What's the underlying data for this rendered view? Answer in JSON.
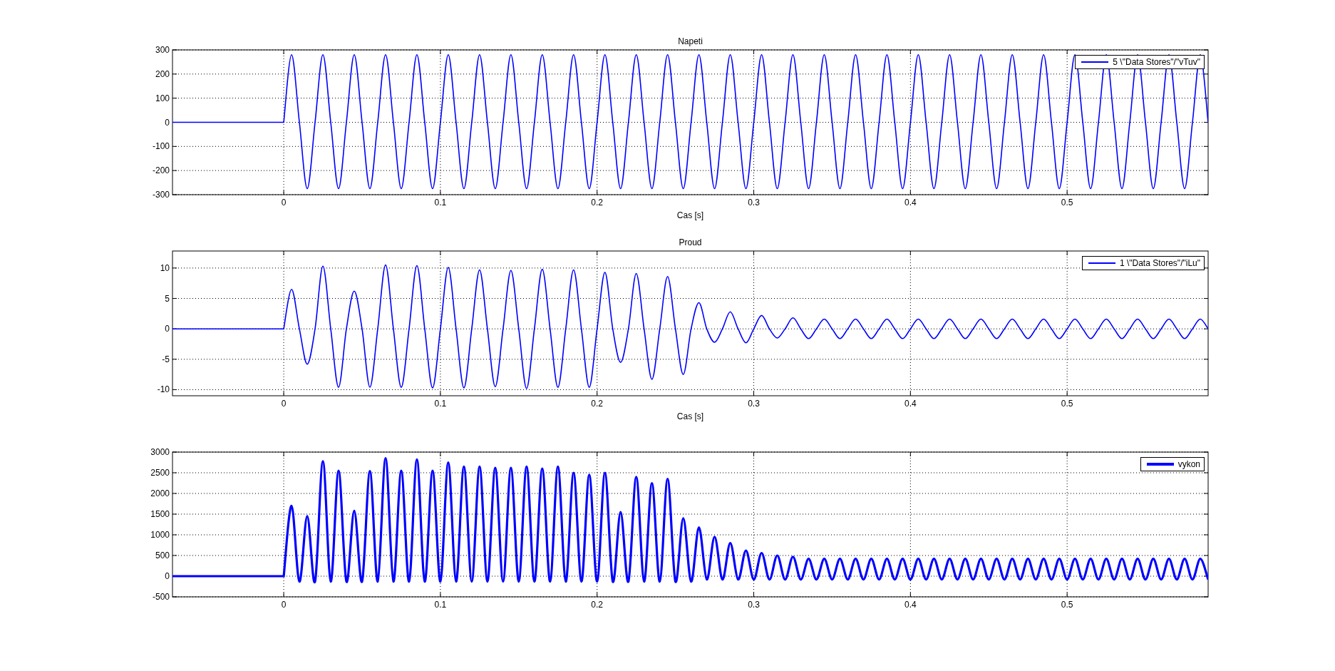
{
  "figure": {
    "axes": [
      {
        "kind": "thin",
        "chart_data": {
          "type": "line",
          "grid": true,
          "title": "Napeti",
          "xlabel": "Cas [s]",
          "xlim": [
            -0.071,
            0.59
          ],
          "ylim": [
            -300,
            300
          ],
          "xticks": [
            0,
            0.1,
            0.2,
            0.3,
            0.4,
            0.5
          ],
          "yticks": [
            -300,
            -200,
            -100,
            0,
            100,
            200,
            300
          ],
          "x": [
            -0.071,
            0,
            0.005,
            0.01,
            0.015,
            0.02,
            0.025,
            0.03,
            0.035,
            0.04,
            0.045,
            0.05,
            0.055,
            0.06,
            0.065,
            0.07,
            0.075,
            0.08,
            0.085,
            0.09,
            0.095,
            0.1,
            0.105,
            0.11,
            0.115,
            0.12,
            0.125,
            0.13,
            0.135,
            0.14,
            0.145,
            0.15,
            0.155,
            0.16,
            0.165,
            0.17,
            0.175,
            0.18,
            0.185,
            0.19,
            0.195,
            0.2,
            0.205,
            0.21,
            0.215,
            0.22,
            0.225,
            0.23,
            0.235,
            0.24,
            0.245,
            0.25,
            0.255,
            0.26,
            0.265,
            0.27,
            0.275,
            0.28,
            0.285,
            0.29,
            0.295,
            0.3,
            0.305,
            0.31,
            0.315,
            0.32,
            0.325,
            0.33,
            0.335,
            0.34,
            0.345,
            0.35,
            0.355,
            0.36,
            0.365,
            0.37,
            0.375,
            0.38,
            0.385,
            0.39,
            0.395,
            0.4,
            0.405,
            0.41,
            0.415,
            0.42,
            0.425,
            0.43,
            0.435,
            0.44,
            0.445,
            0.45,
            0.455,
            0.46,
            0.465,
            0.47,
            0.475,
            0.48,
            0.485,
            0.49,
            0.495,
            0.5,
            0.505,
            0.51,
            0.515,
            0.52,
            0.525,
            0.53,
            0.535,
            0.54,
            0.545,
            0.55,
            0.555,
            0.56,
            0.565,
            0.57,
            0.575,
            0.58,
            0.585,
            0.59
          ],
          "series": [
            {
              "name": "5 \\\"Data Stores\"/\"vTuv\"",
              "color": "#0000ff",
              "values": [
                0,
                0,
                280,
                0,
                -275,
                0,
                280,
                0,
                -275,
                0,
                280,
                0,
                -275,
                0,
                280,
                0,
                -275,
                0,
                280,
                0,
                -275,
                0,
                280,
                0,
                -275,
                0,
                280,
                0,
                -275,
                0,
                280,
                0,
                -275,
                0,
                280,
                0,
                -275,
                0,
                280,
                0,
                -275,
                0,
                280,
                0,
                -275,
                0,
                280,
                0,
                -275,
                0,
                280,
                0,
                -275,
                0,
                280,
                0,
                -275,
                0,
                280,
                0,
                -275,
                0,
                280,
                0,
                -275,
                0,
                280,
                0,
                -275,
                0,
                280,
                0,
                -275,
                0,
                280,
                0,
                -275,
                0,
                280,
                0,
                -275,
                0,
                280,
                0,
                -275,
                0,
                280,
                0,
                -275,
                0,
                280,
                0,
                -275,
                0,
                280,
                0,
                -275,
                0,
                280,
                0,
                -275,
                0,
                280,
                0,
                -275,
                0,
                280,
                0,
                -275,
                0,
                280,
                0,
                -275,
                0,
                280,
                0,
                -275,
                0,
                280,
                0
              ]
            }
          ]
        }
      },
      {
        "kind": "thin",
        "chart_data": {
          "type": "line",
          "grid": true,
          "title": "Proud",
          "xlabel": "Cas [s]",
          "xlim": [
            -0.071,
            0.59
          ],
          "ylim": [
            -11,
            12.8
          ],
          "xticks": [
            0,
            0.1,
            0.2,
            0.3,
            0.4,
            0.5
          ],
          "yticks": [
            -10,
            -5,
            0,
            5,
            10
          ],
          "x": [
            -0.071,
            0,
            0.005,
            0.01,
            0.015,
            0.02,
            0.025,
            0.03,
            0.035,
            0.04,
            0.045,
            0.05,
            0.055,
            0.06,
            0.065,
            0.07,
            0.075,
            0.08,
            0.085,
            0.09,
            0.095,
            0.1,
            0.105,
            0.11,
            0.115,
            0.12,
            0.125,
            0.13,
            0.135,
            0.14,
            0.145,
            0.15,
            0.155,
            0.16,
            0.165,
            0.17,
            0.175,
            0.18,
            0.185,
            0.19,
            0.195,
            0.2,
            0.205,
            0.21,
            0.215,
            0.22,
            0.225,
            0.23,
            0.235,
            0.24,
            0.245,
            0.25,
            0.255,
            0.26,
            0.265,
            0.27,
            0.275,
            0.28,
            0.285,
            0.29,
            0.295,
            0.3,
            0.305,
            0.31,
            0.315,
            0.32,
            0.325,
            0.33,
            0.335,
            0.34,
            0.345,
            0.35,
            0.355,
            0.36,
            0.365,
            0.37,
            0.375,
            0.38,
            0.385,
            0.39,
            0.395,
            0.4,
            0.405,
            0.41,
            0.415,
            0.42,
            0.425,
            0.43,
            0.435,
            0.44,
            0.445,
            0.45,
            0.455,
            0.46,
            0.465,
            0.47,
            0.475,
            0.48,
            0.485,
            0.49,
            0.495,
            0.5,
            0.505,
            0.51,
            0.515,
            0.52,
            0.525,
            0.53,
            0.535,
            0.54,
            0.545,
            0.55,
            0.555,
            0.56,
            0.565,
            0.57,
            0.575,
            0.58,
            0.585,
            0.59
          ],
          "series": [
            {
              "name": "1 \\\"Data Stores\"/\"iLu\"",
              "color": "#0000ff",
              "values": [
                0,
                0,
                6.5,
                0,
                -5.8,
                0,
                10.3,
                0,
                -9.6,
                0,
                6.2,
                0,
                -9.6,
                0,
                10.5,
                0,
                -9.6,
                0,
                10.4,
                0,
                -9.7,
                0,
                10.1,
                0,
                -9.7,
                0,
                9.7,
                0,
                -9.5,
                0,
                9.6,
                0,
                -9.8,
                0,
                9.8,
                0,
                -9.6,
                0,
                9.7,
                0,
                -9.6,
                0,
                9.3,
                0,
                -5.5,
                0,
                9.1,
                0,
                -8.3,
                0,
                8.6,
                0,
                -7.5,
                0,
                4.3,
                0,
                -2.2,
                0,
                2.8,
                0,
                -2.3,
                0,
                2.2,
                0,
                -1.5,
                0,
                1.8,
                0,
                -1.6,
                0,
                1.6,
                0,
                -1.6,
                0,
                1.6,
                0,
                -1.6,
                0,
                1.6,
                0,
                -1.6,
                0,
                1.6,
                0,
                -1.6,
                0,
                1.6,
                0,
                -1.6,
                0,
                1.6,
                0,
                -1.6,
                0,
                1.6,
                0,
                -1.6,
                0,
                1.6,
                0,
                -1.6,
                0,
                1.6,
                0,
                -1.6,
                0,
                1.6,
                0,
                -1.6,
                0,
                1.6,
                0,
                -1.6,
                0,
                1.6,
                0,
                -1.6,
                0,
                1.6,
                0
              ]
            }
          ]
        }
      },
      {
        "kind": "thick",
        "chart_data": {
          "type": "line",
          "grid": true,
          "xlim": [
            -0.071,
            0.59
          ],
          "ylim": [
            -500,
            3000
          ],
          "xticks": [
            0,
            0.1,
            0.2,
            0.3,
            0.4,
            0.5
          ],
          "yticks": [
            -500,
            0,
            500,
            1000,
            1500,
            2000,
            2500,
            3000
          ],
          "x": [
            -0.071,
            0,
            0.005,
            0.01,
            0.015,
            0.02,
            0.025,
            0.03,
            0.035,
            0.04,
            0.045,
            0.05,
            0.055,
            0.06,
            0.065,
            0.07,
            0.075,
            0.08,
            0.085,
            0.09,
            0.095,
            0.1,
            0.105,
            0.11,
            0.115,
            0.12,
            0.125,
            0.13,
            0.135,
            0.14,
            0.145,
            0.15,
            0.155,
            0.16,
            0.165,
            0.17,
            0.175,
            0.18,
            0.185,
            0.19,
            0.195,
            0.2,
            0.205,
            0.21,
            0.215,
            0.22,
            0.225,
            0.23,
            0.235,
            0.24,
            0.245,
            0.25,
            0.255,
            0.26,
            0.265,
            0.27,
            0.275,
            0.28,
            0.285,
            0.29,
            0.295,
            0.3,
            0.305,
            0.31,
            0.315,
            0.32,
            0.325,
            0.33,
            0.335,
            0.34,
            0.345,
            0.35,
            0.355,
            0.36,
            0.365,
            0.37,
            0.375,
            0.38,
            0.385,
            0.39,
            0.395,
            0.4,
            0.405,
            0.41,
            0.415,
            0.42,
            0.425,
            0.43,
            0.435,
            0.44,
            0.445,
            0.45,
            0.455,
            0.46,
            0.465,
            0.47,
            0.475,
            0.48,
            0.485,
            0.49,
            0.495,
            0.5,
            0.505,
            0.51,
            0.515,
            0.52,
            0.525,
            0.53,
            0.535,
            0.54,
            0.545,
            0.55,
            0.555,
            0.56,
            0.565,
            0.57,
            0.575,
            0.58,
            0.585,
            0.59
          ],
          "series": [
            {
              "name": "vykon",
              "color": "#0000ff",
              "values": [
                0,
                0,
                1700,
                -130,
                1450,
                -130,
                2780,
                -130,
                2550,
                -130,
                1580,
                -130,
                2540,
                -130,
                2850,
                -130,
                2550,
                -130,
                2820,
                -130,
                2550,
                -130,
                2750,
                -130,
                2650,
                -130,
                2650,
                -130,
                2620,
                -130,
                2620,
                -130,
                2650,
                -130,
                2600,
                -130,
                2650,
                -130,
                2500,
                -130,
                2450,
                -130,
                2500,
                -130,
                1550,
                -130,
                2400,
                -130,
                2250,
                -130,
                2350,
                -130,
                1400,
                -130,
                1180,
                -80,
                950,
                -80,
                800,
                -80,
                620,
                -80,
                560,
                -80,
                500,
                -80,
                470,
                -80,
                420,
                -80,
                420,
                -80,
                420,
                -80,
                420,
                -80,
                420,
                -80,
                420,
                -80,
                420,
                -80,
                420,
                -80,
                420,
                -80,
                420,
                -80,
                420,
                -80,
                420,
                -80,
                420,
                -80,
                420,
                -80,
                420,
                -80,
                420,
                -80,
                420,
                -80,
                420,
                -80,
                420,
                -80,
                420,
                -80,
                420,
                -80,
                420,
                -80,
                420,
                -80,
                420,
                -80,
                420,
                -80,
                420,
                -80
              ]
            }
          ]
        }
      }
    ]
  }
}
